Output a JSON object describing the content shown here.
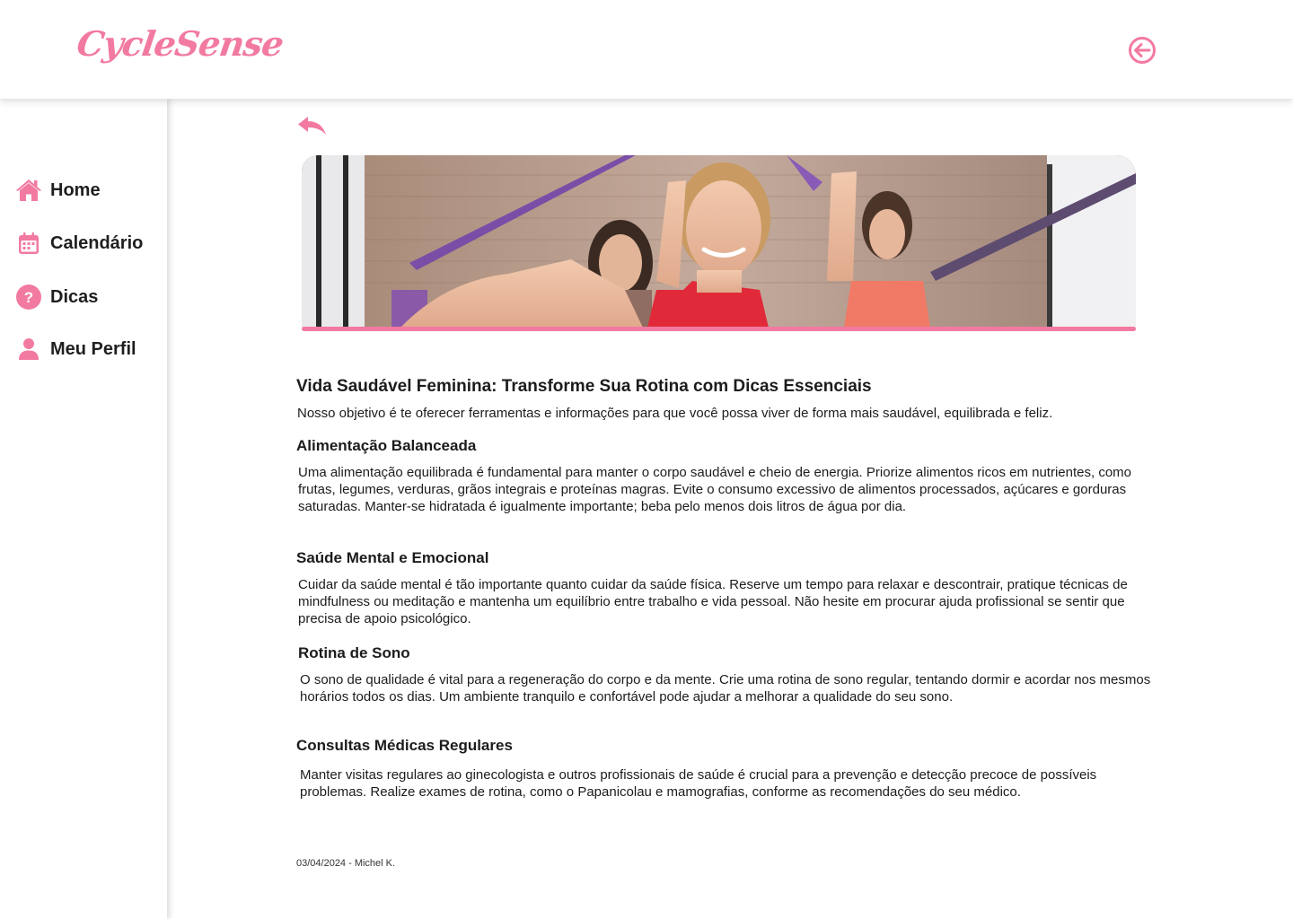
{
  "app": {
    "brand": "CycleSense",
    "accent_color": "#f27aa0"
  },
  "header": {
    "logout_icon": "logout-arrow-circle-icon"
  },
  "sidebar": {
    "items": [
      {
        "label": "Home",
        "icon": "home-icon"
      },
      {
        "label": "Calendário",
        "icon": "calendar-icon"
      },
      {
        "label": "Dicas",
        "icon": "question-circle-icon"
      },
      {
        "label": "Meu Perfil",
        "icon": "user-icon"
      }
    ]
  },
  "article": {
    "back_icon": "reply-arrow-icon",
    "hero_image": "women-exercising-with-resistance-bands",
    "title": "Vida Saudável Feminina: Transforme Sua Rotina com Dicas Essenciais",
    "intro": "Nosso objetivo é te oferecer ferramentas e informações para que você possa viver de forma mais saudável, equilibrada e feliz.",
    "sections": [
      {
        "title": "Alimentação Balanceada",
        "body": "Uma alimentação equilibrada é fundamental para manter o corpo saudável e cheio de energia. Priorize alimentos ricos em nutrientes, como frutas, legumes, verduras, grãos integrais e proteínas magras. Evite o consumo excessivo de alimentos processados, açúcares e gorduras saturadas. Manter-se hidratada é igualmente importante; beba pelo menos dois litros de água por dia."
      },
      {
        "title": "Saúde Mental e Emocional",
        "body": "Cuidar da saúde mental é tão importante quanto cuidar da saúde física. Reserve um tempo para relaxar e descontrair, pratique técnicas de mindfulness ou meditação e mantenha um equilíbrio entre trabalho e vida pessoal. Não hesite em procurar ajuda profissional se sentir que precisa de apoio psicológico."
      },
      {
        "title": "Rotina de Sono",
        "body": "O sono de qualidade é vital para a regeneração do corpo e da mente. Crie uma rotina de sono regular, tentando dormir e acordar nos mesmos horários todos os dias. Um ambiente tranquilo e confortável pode ajudar a melhorar a qualidade do seu sono."
      },
      {
        "title": "Consultas Médicas Regulares",
        "body": "Manter visitas regulares ao ginecologista e outros profissionais de saúde é crucial para a prevenção e detecção precoce de possíveis problemas. Realize exames de rotina, como o Papanicolau e mamografias, conforme as recomendações do seu médico."
      }
    ],
    "meta": "03/04/2024 - Michel K."
  }
}
